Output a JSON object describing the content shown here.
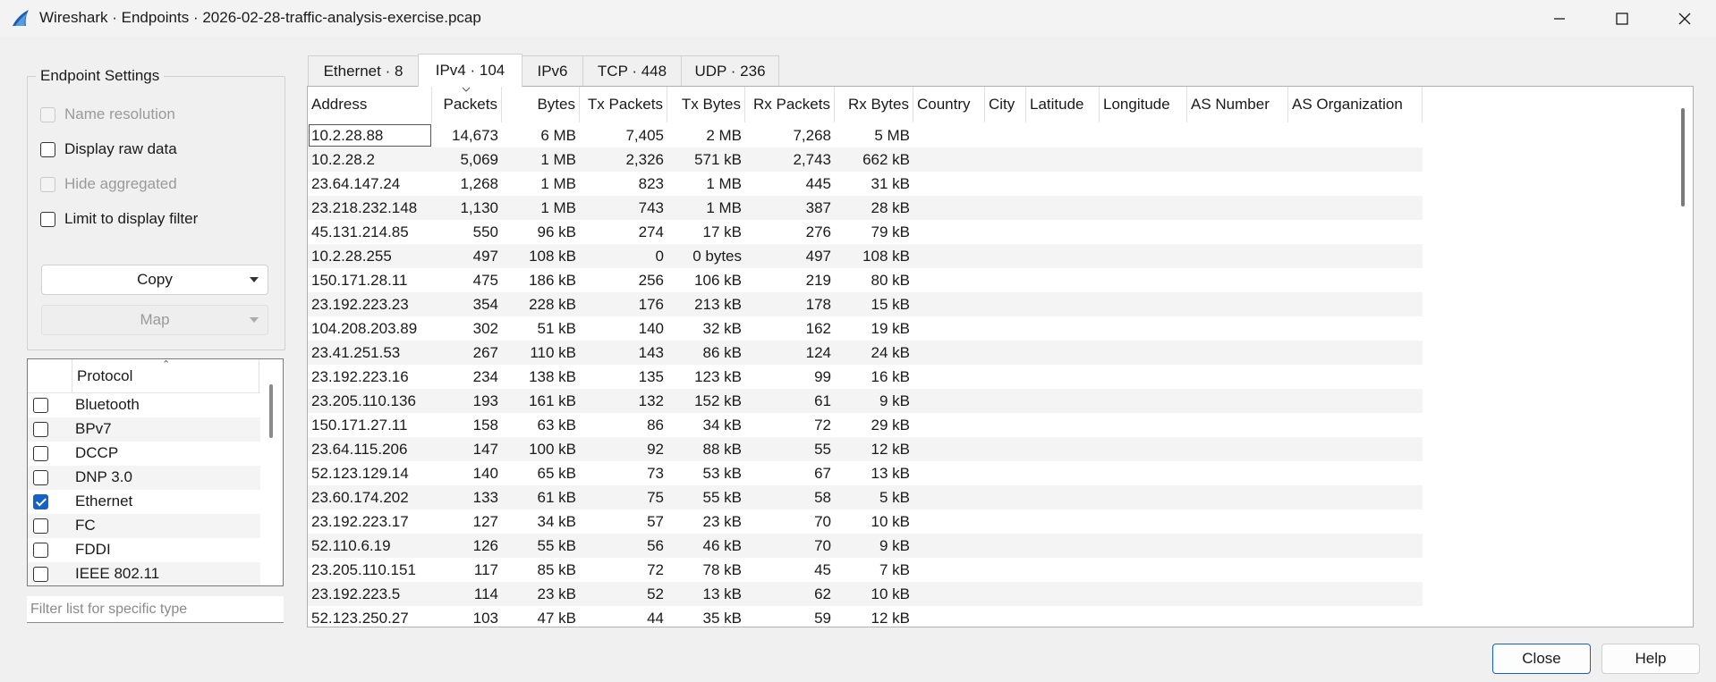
{
  "window": {
    "title": "Wireshark · Endpoints · 2026-02-28-traffic-analysis-exercise.pcap",
    "minimize_icon": "minimize-icon",
    "maximize_icon": "maximize-icon",
    "close_icon": "close-icon"
  },
  "settings": {
    "title": "Endpoint Settings",
    "name_resolution": "Name resolution",
    "display_raw_data": "Display raw data",
    "hide_aggregated": "Hide aggregated",
    "limit_to_filter": "Limit to display filter",
    "copy_label": "Copy",
    "map_label": "Map"
  },
  "protocols": {
    "header": "Protocol",
    "items": [
      {
        "label": "Bluetooth",
        "checked": false
      },
      {
        "label": "BPv7",
        "checked": false
      },
      {
        "label": "DCCP",
        "checked": false
      },
      {
        "label": "DNP 3.0",
        "checked": false
      },
      {
        "label": "Ethernet",
        "checked": true
      },
      {
        "label": "FC",
        "checked": false
      },
      {
        "label": "FDDI",
        "checked": false
      },
      {
        "label": "IEEE 802.11",
        "checked": false
      }
    ],
    "filter_placeholder": "Filter list for specific type"
  },
  "tabs": [
    {
      "label": "Ethernet · 8"
    },
    {
      "label": "IPv4 · 104"
    },
    {
      "label": "IPv6"
    },
    {
      "label": "TCP · 448"
    },
    {
      "label": "UDP · 236"
    }
  ],
  "active_tab": "IPv4 · 104",
  "table": {
    "columns": [
      "Address",
      "Packets",
      "Bytes",
      "Tx Packets",
      "Tx Bytes",
      "Rx Packets",
      "Rx Bytes",
      "Country",
      "City",
      "Latitude",
      "Longitude",
      "AS Number",
      "AS Organization"
    ],
    "rows": [
      [
        "10.2.28.88",
        "14,673",
        "6 MB",
        "7,405",
        "2 MB",
        "7,268",
        "5 MB"
      ],
      [
        "10.2.28.2",
        "5,069",
        "1 MB",
        "2,326",
        "571 kB",
        "2,743",
        "662 kB"
      ],
      [
        "23.64.147.24",
        "1,268",
        "1 MB",
        "823",
        "1 MB",
        "445",
        "31 kB"
      ],
      [
        "23.218.232.148",
        "1,130",
        "1 MB",
        "743",
        "1 MB",
        "387",
        "28 kB"
      ],
      [
        "45.131.214.85",
        "550",
        "96 kB",
        "274",
        "17 kB",
        "276",
        "79 kB"
      ],
      [
        "10.2.28.255",
        "497",
        "108 kB",
        "0",
        "0 bytes",
        "497",
        "108 kB"
      ],
      [
        "150.171.28.11",
        "475",
        "186 kB",
        "256",
        "106 kB",
        "219",
        "80 kB"
      ],
      [
        "23.192.223.23",
        "354",
        "228 kB",
        "176",
        "213 kB",
        "178",
        "15 kB"
      ],
      [
        "104.208.203.89",
        "302",
        "51 kB",
        "140",
        "32 kB",
        "162",
        "19 kB"
      ],
      [
        "23.41.251.53",
        "267",
        "110 kB",
        "143",
        "86 kB",
        "124",
        "24 kB"
      ],
      [
        "23.192.223.16",
        "234",
        "138 kB",
        "135",
        "123 kB",
        "99",
        "16 kB"
      ],
      [
        "23.205.110.136",
        "193",
        "161 kB",
        "132",
        "152 kB",
        "61",
        "9 kB"
      ],
      [
        "150.171.27.11",
        "158",
        "63 kB",
        "86",
        "34 kB",
        "72",
        "29 kB"
      ],
      [
        "23.64.115.206",
        "147",
        "100 kB",
        "92",
        "88 kB",
        "55",
        "12 kB"
      ],
      [
        "52.123.129.14",
        "140",
        "65 kB",
        "73",
        "53 kB",
        "67",
        "13 kB"
      ],
      [
        "23.60.174.202",
        "133",
        "61 kB",
        "75",
        "55 kB",
        "58",
        "5 kB"
      ],
      [
        "23.192.223.17",
        "127",
        "34 kB",
        "57",
        "23 kB",
        "70",
        "10 kB"
      ],
      [
        "52.110.6.19",
        "126",
        "55 kB",
        "56",
        "46 kB",
        "70",
        "9 kB"
      ],
      [
        "23.205.110.151",
        "117",
        "85 kB",
        "72",
        "78 kB",
        "45",
        "7 kB"
      ],
      [
        "23.192.223.5",
        "114",
        "23 kB",
        "52",
        "13 kB",
        "62",
        "10 kB"
      ],
      [
        "52.123.250.27",
        "103",
        "47 kB",
        "44",
        "35 kB",
        "59",
        "12 kB"
      ]
    ]
  },
  "buttons": {
    "close": "Close",
    "help": "Help"
  },
  "colors": {
    "accent": "#1561c5",
    "app_icon": "#1d5fb4"
  }
}
